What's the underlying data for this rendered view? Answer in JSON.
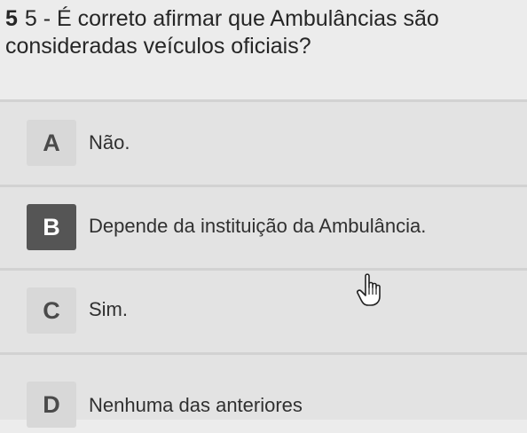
{
  "question": {
    "number": "5",
    "text": "5 - É correto afirmar que Ambulâncias são consideradas veículos oficiais?"
  },
  "options": [
    {
      "letter": "A",
      "text": "Não."
    },
    {
      "letter": "B",
      "text": "Depende da instituição da Ambulância."
    },
    {
      "letter": "C",
      "text": "Sim."
    },
    {
      "letter": "D",
      "text": "Nenhuma das anteriores"
    }
  ],
  "selected_option": "B",
  "cursor_icon": "hand-pointer-icon",
  "colors": {
    "background": "#ececec",
    "selected_badge": "#555555",
    "badge": "#d8d8d8"
  }
}
